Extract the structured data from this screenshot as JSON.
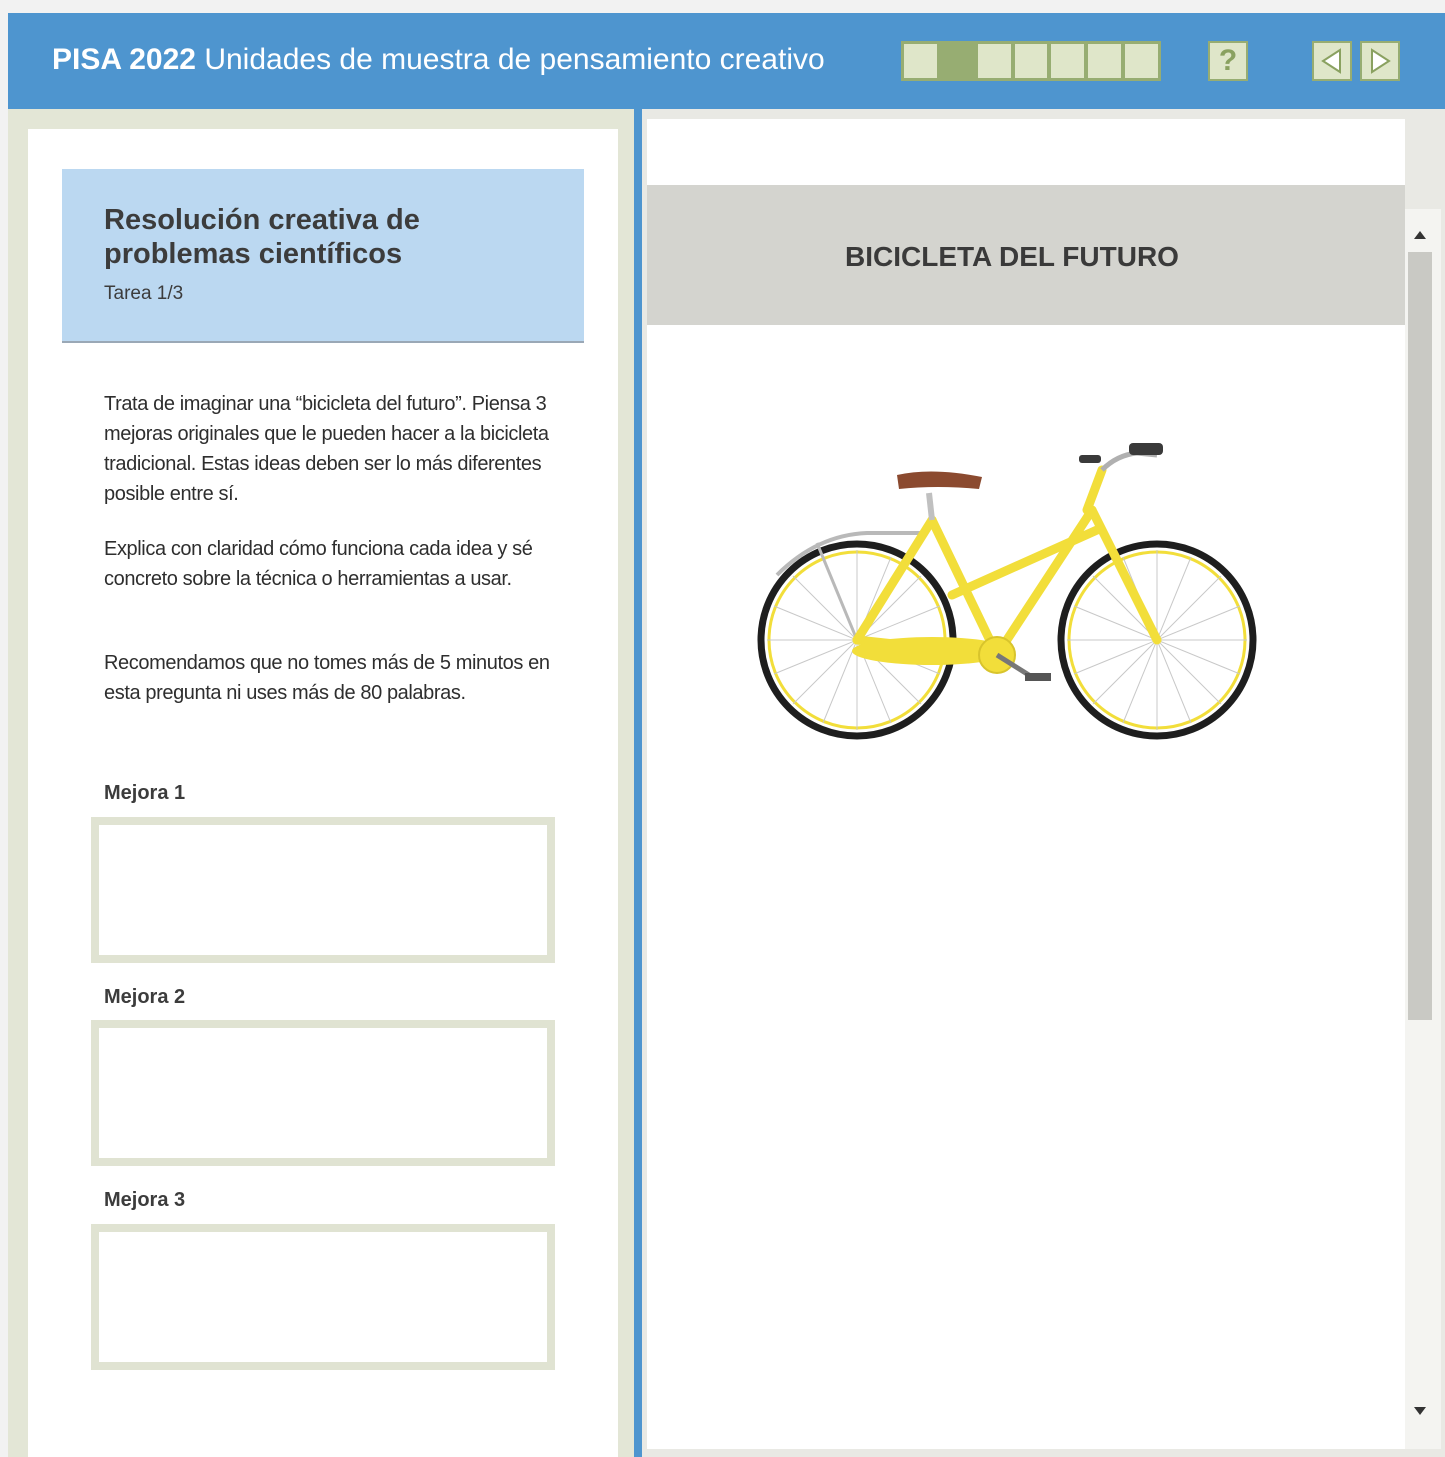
{
  "header": {
    "title_bold": "PISA 2022",
    "title_rest": " Unidades de muestra de pensamiento creativo",
    "progress_total_segments": 7,
    "progress_current_segment": 2,
    "help_label": "?"
  },
  "task": {
    "title": "Resolución creativa de problemas científicos",
    "subtitle": "Tarea 1/3",
    "paragraphs": [
      "Trata de imaginar una “bicicleta del futuro”. Piensa 3 mejoras originales que le pueden hacer a la bicicleta tradicional. Estas ideas deben ser lo más diferentes posible entre sí.",
      "Explica con claridad cómo funciona cada idea y sé concreto sobre la técnica o herramientas a usar.",
      "Recomendamos que no tomes más de 5 minutos en esta pregunta ni uses más de 80 palabras."
    ],
    "answers": [
      {
        "label": "Mejora 1",
        "value": ""
      },
      {
        "label": "Mejora 2",
        "value": ""
      },
      {
        "label": "Mejora 3",
        "value": ""
      }
    ]
  },
  "stimulus": {
    "title": "BICICLETA DEL FUTURO",
    "image": "yellow-bicycle-image"
  },
  "colors": {
    "header_bg": "#4e95cf",
    "progress_active": "#97ad72",
    "progress_inactive": "#dfe6c9",
    "task_header_bg": "#bbd8f1",
    "answer_border": "#e0e3d2",
    "stimulus_banner_bg": "#d4d4cf",
    "bike_frame": "#f2de3a"
  }
}
